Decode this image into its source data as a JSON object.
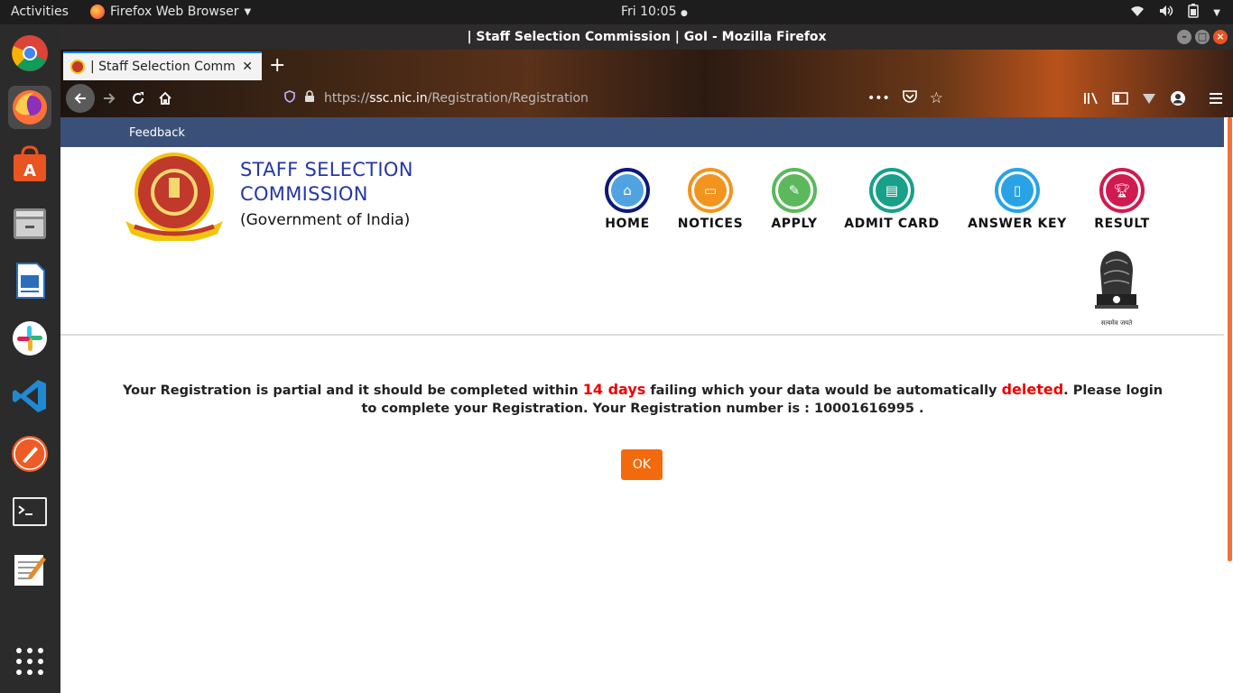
{
  "system": {
    "activities": "Activities",
    "app_name": "Firefox Web Browser",
    "clock": "Fri 10:05"
  },
  "browser": {
    "window_title": "| Staff Selection Commission | GoI - Mozilla Firefox",
    "tab_title": "| Staff Selection Commis",
    "url_scheme": "https://",
    "url_host": "ssc.nic.in",
    "url_path": "/Registration/Registration"
  },
  "page": {
    "strip_link": "Feedback",
    "org": {
      "line1": "STAFF SELECTION",
      "line2": "COMMISSION",
      "line3": "(Government of India)"
    },
    "menu": [
      {
        "label": "HOME",
        "icon": "home-icon",
        "ring": "#0a1a7a",
        "fill": "#4fa3e0"
      },
      {
        "label": "NOTICES",
        "icon": "notices-icon",
        "ring": "#f3941f",
        "fill": "#f3941f"
      },
      {
        "label": "APPLY",
        "icon": "edit-icon",
        "ring": "#5cb85c",
        "fill": "#5cb85c"
      },
      {
        "label": "ADMIT CARD",
        "icon": "id-card-icon",
        "ring": "#17a08a",
        "fill": "#17a08a"
      },
      {
        "label": "ANSWER KEY",
        "icon": "document-icon",
        "ring": "#29a3e6",
        "fill": "#29a3e6"
      },
      {
        "label": "RESULT",
        "icon": "trophy-icon",
        "ring": "#d11a4f",
        "fill": "#d11a4f"
      }
    ],
    "emblem_caption": "सत्यमेव जयते",
    "message": {
      "part1": "Your Registration is partial and it should be completed within ",
      "days": "14 days",
      "part2": " failing which your data would be automatically ",
      "deleted": "deleted",
      "part3": ". Please login to complete your Registration. Your Registration number is : 10001616995 ."
    },
    "ok_label": "OK"
  }
}
